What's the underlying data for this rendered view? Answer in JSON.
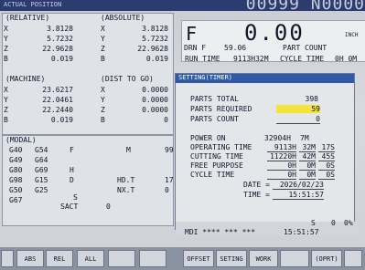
{
  "header": {
    "program_number": "00999 N0000",
    "mode_text": "ACTUAL POSITION"
  },
  "relative": {
    "title": "(RELATIVE)",
    "axes": [
      {
        "axis": "X",
        "value": "3.8128"
      },
      {
        "axis": "Y",
        "value": "5.7232"
      },
      {
        "axis": "Z",
        "value": "22.9628"
      },
      {
        "axis": "B",
        "value": "0.019"
      }
    ]
  },
  "absolute": {
    "title": "(ABSOLUTE)",
    "axes": [
      {
        "axis": "X",
        "value": "3.8128"
      },
      {
        "axis": "Y",
        "value": "5.7232"
      },
      {
        "axis": "Z",
        "value": "22.9628"
      },
      {
        "axis": "B",
        "value": "0.019"
      }
    ]
  },
  "machine": {
    "title": "(MACHINE)",
    "axes": [
      {
        "axis": "X",
        "value": "23.6217"
      },
      {
        "axis": "Y",
        "value": "22.0461"
      },
      {
        "axis": "Z",
        "value": "22.2440"
      },
      {
        "axis": "B",
        "value": "0.019"
      }
    ]
  },
  "dist_to_go": {
    "title": "(DIST TO GO)",
    "axes": [
      {
        "axis": "X",
        "value": "0.0000"
      },
      {
        "axis": "Y",
        "value": "0.0000"
      },
      {
        "axis": "Z",
        "value": "0.0000"
      },
      {
        "axis": "B",
        "value": "0"
      }
    ]
  },
  "modal": {
    "title": "(MODAL)",
    "rows": [
      {
        "a": "G40",
        "b": "G54",
        "c": "F",
        "d": "M",
        "e": "99"
      },
      {
        "a": "G49",
        "b": "G64",
        "c": "",
        "d": "",
        "e": ""
      },
      {
        "a": "G80",
        "b": "G69",
        "c": "H",
        "d": "",
        "e": ""
      },
      {
        "a": "G98",
        "b": "G15",
        "c": "D",
        "d": "HD.T",
        "e": "17"
      },
      {
        "a": "G50",
        "b": "G25",
        "c": "",
        "d": "NX.T",
        "e": "0"
      },
      {
        "a": "G67",
        "b": "",
        "c": "S",
        "d": "",
        "e": ""
      }
    ],
    "sact_label": "SACT",
    "sact_value": "0"
  },
  "feed": {
    "F_label": "F",
    "F_value": "0.00",
    "unit": "INCH",
    "drn_label": "DRN F",
    "drn_value": "59.06",
    "part_count_label": "PART COUNT",
    "run_time_label": "RUN TIME",
    "run_time_value": "9113H32M",
    "cycle_time_label": "CYCLE TIME",
    "cycle_time_value": "0H 0M"
  },
  "settings": {
    "title": "SETTING(TIMER)",
    "parts_total_label": "PARTS TOTAL",
    "parts_total": "398",
    "parts_required_label": "PARTS REQUIRED",
    "parts_required": "59",
    "parts_count_label": "PARTS COUNT",
    "parts_count": "0",
    "power_on_label": "POWER ON",
    "power_on_h": "32904H",
    "power_on_m": "7M",
    "operating_label": "OPERATING TIME",
    "operating_h": "9113H",
    "operating_m": "32M",
    "operating_s": "17S",
    "cutting_label": "CUTTING TIME",
    "cutting_h": "11220H",
    "cutting_m": "42M",
    "cutting_s": "45S",
    "free_label": "FREE PURPOSE",
    "free_h": "0H",
    "free_m": "0M",
    "free_s": "0S",
    "cycle_label": "CYCLE TIME",
    "cycle_h": "0H",
    "cycle_m": "0M",
    "cycle_s": "0S",
    "date_label": "DATE =",
    "date_value": "2026/02/23",
    "time_label": "TIME =",
    "time_value": "15:51:57"
  },
  "status": {
    "s_label": "S",
    "s_value": "0",
    "l_value": "0%",
    "mode": "MDI **** *** ***",
    "clock": "15:51:57"
  },
  "softkeys": [
    {
      "label": "ABS"
    },
    {
      "label": "REL"
    },
    {
      "label": "ALL"
    },
    {
      "label": "OFFSET"
    },
    {
      "label": "SETING"
    },
    {
      "label": "WORK"
    },
    {
      "label": ""
    },
    {
      "label": "(OPRT)"
    }
  ]
}
